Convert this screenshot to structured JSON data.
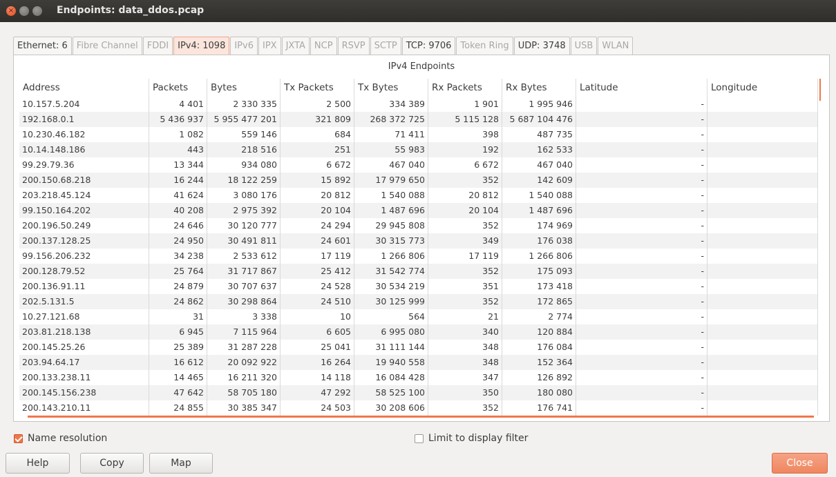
{
  "window": {
    "title": "Endpoints: data_ddos.pcap"
  },
  "tabs": [
    {
      "label": "Ethernet: 6",
      "state": "enabled"
    },
    {
      "label": "Fibre Channel",
      "state": "disabled"
    },
    {
      "label": "FDDI",
      "state": "disabled"
    },
    {
      "label": "IPv4: 1098",
      "state": "active"
    },
    {
      "label": "IPv6",
      "state": "disabled"
    },
    {
      "label": "IPX",
      "state": "disabled"
    },
    {
      "label": "JXTA",
      "state": "disabled"
    },
    {
      "label": "NCP",
      "state": "disabled"
    },
    {
      "label": "RSVP",
      "state": "disabled"
    },
    {
      "label": "SCTP",
      "state": "disabled"
    },
    {
      "label": "TCP: 9706",
      "state": "enabled"
    },
    {
      "label": "Token Ring",
      "state": "disabled"
    },
    {
      "label": "UDP: 3748",
      "state": "enabled"
    },
    {
      "label": "USB",
      "state": "disabled"
    },
    {
      "label": "WLAN",
      "state": "disabled"
    }
  ],
  "table": {
    "title": "IPv4 Endpoints",
    "columns": [
      "Address",
      "Packets",
      "Bytes",
      "Tx Packets",
      "Tx Bytes",
      "Rx Packets",
      "Rx Bytes",
      "Latitude",
      "Longitude"
    ],
    "rows": [
      [
        "10.157.5.204",
        "4 401",
        "2 330 335",
        "2 500",
        "334 389",
        "1 901",
        "1 995 946",
        "-",
        ""
      ],
      [
        "192.168.0.1",
        "5 436 937",
        "5 955 477 201",
        "321 809",
        "268 372 725",
        "5 115 128",
        "5 687 104 476",
        "-",
        ""
      ],
      [
        "10.230.46.182",
        "1 082",
        "559 146",
        "684",
        "71 411",
        "398",
        "487 735",
        "-",
        ""
      ],
      [
        "10.14.148.186",
        "443",
        "218 516",
        "251",
        "55 983",
        "192",
        "162 533",
        "-",
        ""
      ],
      [
        "99.29.79.36",
        "13 344",
        "934 080",
        "6 672",
        "467 040",
        "6 672",
        "467 040",
        "-",
        ""
      ],
      [
        "200.150.68.218",
        "16 244",
        "18 122 259",
        "15 892",
        "17 979 650",
        "352",
        "142 609",
        "-",
        ""
      ],
      [
        "203.218.45.124",
        "41 624",
        "3 080 176",
        "20 812",
        "1 540 088",
        "20 812",
        "1 540 088",
        "-",
        ""
      ],
      [
        "99.150.164.202",
        "40 208",
        "2 975 392",
        "20 104",
        "1 487 696",
        "20 104",
        "1 487 696",
        "-",
        ""
      ],
      [
        "200.196.50.249",
        "24 646",
        "30 120 777",
        "24 294",
        "29 945 808",
        "352",
        "174 969",
        "-",
        ""
      ],
      [
        "200.137.128.25",
        "24 950",
        "30 491 811",
        "24 601",
        "30 315 773",
        "349",
        "176 038",
        "-",
        ""
      ],
      [
        "99.156.206.232",
        "34 238",
        "2 533 612",
        "17 119",
        "1 266 806",
        "17 119",
        "1 266 806",
        "-",
        ""
      ],
      [
        "200.128.79.52",
        "25 764",
        "31 717 867",
        "25 412",
        "31 542 774",
        "352",
        "175 093",
        "-",
        ""
      ],
      [
        "200.136.91.11",
        "24 879",
        "30 707 637",
        "24 528",
        "30 534 219",
        "351",
        "173 418",
        "-",
        ""
      ],
      [
        "202.5.131.5",
        "24 862",
        "30 298 864",
        "24 510",
        "30 125 999",
        "352",
        "172 865",
        "-",
        ""
      ],
      [
        "10.27.121.68",
        "31",
        "3 338",
        "10",
        "564",
        "21",
        "2 774",
        "-",
        ""
      ],
      [
        "203.81.218.138",
        "6 945",
        "7 115 964",
        "6 605",
        "6 995 080",
        "340",
        "120 884",
        "-",
        ""
      ],
      [
        "200.145.25.26",
        "25 389",
        "31 287 228",
        "25 041",
        "31 111 144",
        "348",
        "176 084",
        "-",
        ""
      ],
      [
        "203.94.64.17",
        "16 612",
        "20 092 922",
        "16 264",
        "19 940 558",
        "348",
        "152 364",
        "-",
        ""
      ],
      [
        "200.133.238.11",
        "14 465",
        "16 211 320",
        "14 118",
        "16 084 428",
        "347",
        "126 892",
        "-",
        ""
      ],
      [
        "200.145.156.238",
        "47 642",
        "58 705 180",
        "47 292",
        "58 525 100",
        "350",
        "180 080",
        "-",
        ""
      ],
      [
        "200.143.210.11",
        "24 855",
        "30 385 347",
        "24 503",
        "30 208 606",
        "352",
        "176 741",
        "-",
        ""
      ]
    ]
  },
  "options": {
    "name_resolution": {
      "label": "Name resolution",
      "checked": true
    },
    "limit_filter": {
      "label": "Limit to display filter",
      "checked": false
    }
  },
  "buttons": {
    "help": "Help",
    "copy": "Copy",
    "map": "Map",
    "close": "Close"
  },
  "colors": {
    "accent": "#f0774a"
  }
}
